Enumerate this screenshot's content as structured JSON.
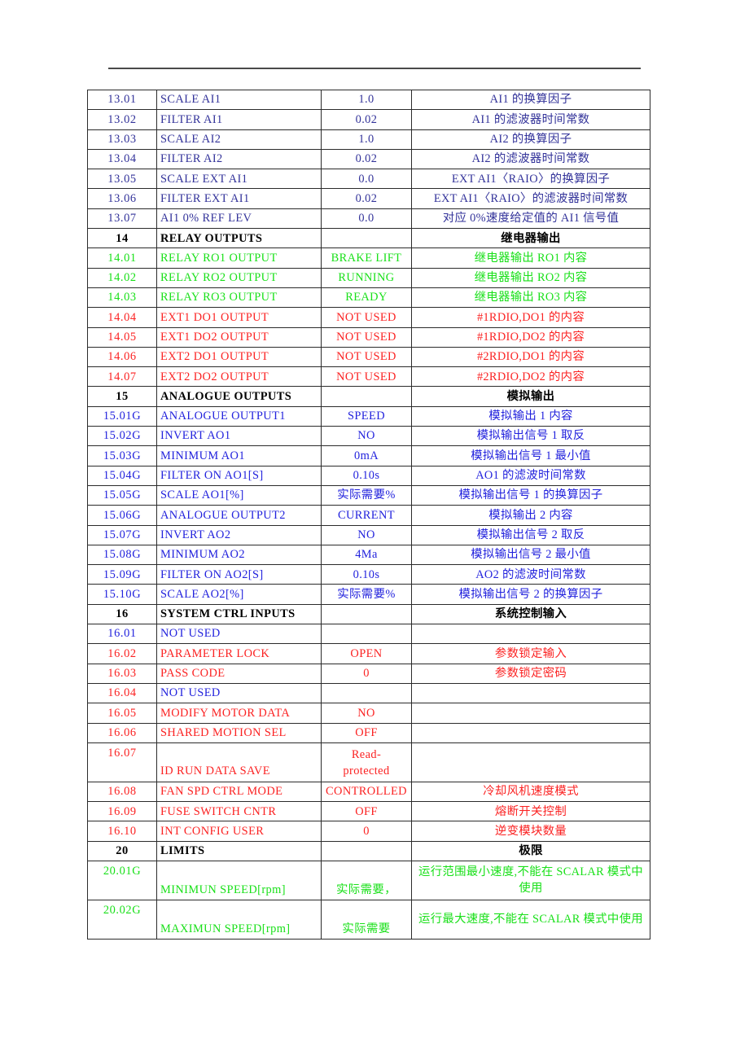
{
  "document": {
    "header_rule": true,
    "colors": {
      "navy": "#33339a",
      "blue": "#2222dd",
      "green": "#19e019",
      "red": "#fb2222",
      "black": "#000000",
      "border": "#2b2b2b",
      "rule": "#4a4a4a"
    }
  },
  "table": {
    "columns": [
      "id",
      "name",
      "value",
      "description"
    ],
    "rows": [
      {
        "type": "row",
        "id": "13.01",
        "name": "SCALE AI1",
        "value": "1.0",
        "desc": "AI1 的换算因子",
        "color": "navy"
      },
      {
        "type": "row",
        "id": "13.02",
        "name": "FILTER AI1",
        "value": "0.02",
        "desc": "AI1 的滤波器时间常数",
        "color": "navy"
      },
      {
        "type": "row",
        "id": "13.03",
        "name": "SCALE AI2",
        "value": "1.0",
        "desc": "AI2 的换算因子",
        "color": "navy"
      },
      {
        "type": "row",
        "id": "13.04",
        "name": "FILTER AI2",
        "value": "0.02",
        "desc": "AI2 的滤波器时间常数",
        "color": "navy"
      },
      {
        "type": "row",
        "id": "13.05",
        "name": "SCALE EXT AI1",
        "value": "0.0",
        "desc": "EXT AI1〈RAIO〉的换算因子",
        "color": "navy"
      },
      {
        "type": "row",
        "id": "13.06",
        "name": "FILTER EXT AI1",
        "value": "0.02",
        "desc": "EXT AI1〈RAIO〉的滤波器时间常数",
        "color": "navy"
      },
      {
        "type": "row",
        "id": "13.07",
        "name": "AI1 0% REF LEV",
        "value": "0.0",
        "desc": "对应 0%速度给定值的 AI1 信号值",
        "color": "navy"
      },
      {
        "type": "section",
        "id": "14",
        "name": "RELAY OUTPUTS",
        "value": "",
        "desc": "继电器输出",
        "color": "black"
      },
      {
        "type": "row",
        "id": "14.01",
        "name": "RELAY RO1 OUTPUT",
        "value": "BRAKE LIFT",
        "desc": "继电器输出 RO1 内容",
        "color": "green"
      },
      {
        "type": "row",
        "id": "14.02",
        "name": "RELAY RO2 OUTPUT",
        "value": "RUNNING",
        "desc": "继电器输出 RO2 内容",
        "color": "green"
      },
      {
        "type": "row",
        "id": "14.03",
        "name": "RELAY RO3 OUTPUT",
        "value": "READY",
        "desc": "继电器输出 RO3 内容",
        "color": "green"
      },
      {
        "type": "row",
        "id": "14.04",
        "name": "EXT1 DO1 OUTPUT",
        "value": "NOT USED",
        "desc": "#1RDIO,DO1 的内容",
        "color": "red"
      },
      {
        "type": "row",
        "id": "14.05",
        "name": "EXT1 DO2 OUTPUT",
        "value": "NOT USED",
        "desc": "#1RDIO,DO2 的内容",
        "color": "red"
      },
      {
        "type": "row",
        "id": "14.06",
        "name": "EXT2 DO1 OUTPUT",
        "value": "NOT USED",
        "desc": "#2RDIO,DO1 的内容",
        "color": "red"
      },
      {
        "type": "row",
        "id": "14.07",
        "name": "EXT2 DO2 OUTPUT",
        "value": "NOT USED",
        "desc": "#2RDIO,DO2 的内容",
        "color": "red"
      },
      {
        "type": "section",
        "id": "15",
        "name": "ANALOGUE OUTPUTS",
        "value": "",
        "desc": "模拟输出",
        "color": "black"
      },
      {
        "type": "row",
        "id": "15.01G",
        "name": "ANALOGUE OUTPUT1",
        "value": "SPEED",
        "desc": "模拟输出 1 内容",
        "color": "blue"
      },
      {
        "type": "row",
        "id": "15.02G",
        "name": "INVERT AO1",
        "value": "NO",
        "desc": "模拟输出信号 1 取反",
        "color": "blue"
      },
      {
        "type": "row",
        "id": "15.03G",
        "name": "MINIMUM AO1",
        "value": "0mA",
        "desc": "模拟输出信号 1 最小值",
        "color": "blue"
      },
      {
        "type": "row",
        "id": "15.04G",
        "name": "FILTER ON AO1[S]",
        "value": "0.10s",
        "desc": "AO1 的滤波时间常数",
        "color": "blue"
      },
      {
        "type": "row",
        "id": "15.05G",
        "name": "SCALE AO1[%]",
        "value": "实际需要%",
        "desc": "模拟输出信号 1 的换算因子",
        "color": "blue"
      },
      {
        "type": "row",
        "id": "15.06G",
        "name": "ANALOGUE OUTPUT2",
        "value": "CURRENT",
        "desc": "模拟输出 2 内容",
        "color": "blue"
      },
      {
        "type": "row",
        "id": "15.07G",
        "name": "INVERT AO2",
        "value": "NO",
        "desc": "模拟输出信号 2 取反",
        "color": "blue"
      },
      {
        "type": "row",
        "id": "15.08G",
        "name": "MINIMUM AO2",
        "value": "4Ma",
        "desc": "模拟输出信号 2 最小值",
        "color": "blue"
      },
      {
        "type": "row",
        "id": "15.09G",
        "name": "FILTER ON AO2[S]",
        "value": "0.10s",
        "desc": "AO2 的滤波时间常数",
        "color": "blue"
      },
      {
        "type": "row",
        "id": "15.10G",
        "name": "SCALE AO2[%]",
        "value": "实际需要%",
        "desc": "模拟输出信号 2 的换算因子",
        "color": "blue"
      },
      {
        "type": "section",
        "id": "16",
        "name": "SYSTEM CTRL INPUTS",
        "value": "",
        "desc": "系统控制输入",
        "color": "black"
      },
      {
        "type": "row",
        "id": "16.01",
        "name": "NOT USED",
        "value": "",
        "desc": "",
        "color": "blue",
        "id_color": "blue"
      },
      {
        "type": "row",
        "id": "16.02",
        "name": "PARAMETER LOCK",
        "value": "OPEN",
        "desc": "参数锁定输入",
        "color": "red"
      },
      {
        "type": "row",
        "id": "16.03",
        "name": "PASS CODE",
        "value": "0",
        "desc": "参数锁定密码",
        "color": "red"
      },
      {
        "type": "row",
        "id": "16.04",
        "name": "NOT USED",
        "value": "",
        "desc": "",
        "color": "blue",
        "id_color": "red"
      },
      {
        "type": "row",
        "id": "16.05",
        "name": "MODIFY MOTOR DATA",
        "value": "NO",
        "desc": "",
        "color": "red"
      },
      {
        "type": "row",
        "id": "16.06",
        "name": "SHARED MOTION SEL",
        "value": "OFF",
        "desc": "",
        "color": "red"
      },
      {
        "type": "tall",
        "id": "16.07",
        "name": "ID RUN DATA SAVE",
        "value": "Read-\nprotected",
        "desc": "",
        "color": "red"
      },
      {
        "type": "row",
        "id": "16.08",
        "name": "FAN SPD CTRL MODE",
        "value": "CONTROLLED",
        "desc": "冷却风机速度模式",
        "color": "red"
      },
      {
        "type": "row",
        "id": "16.09",
        "name": "FUSE SWITCH CNTR",
        "value": "OFF",
        "desc": "熔断开关控制",
        "color": "red"
      },
      {
        "type": "row",
        "id": "16.10",
        "name": "INT CONFIG USER",
        "value": "0",
        "desc": "逆变模块数量",
        "color": "red"
      },
      {
        "type": "section",
        "id": "20",
        "name": "LIMITS",
        "value": "",
        "desc": "极限",
        "color": "black"
      },
      {
        "type": "tall",
        "id": "20.01G",
        "name": "MINIMUN SPEED[rpm]",
        "value": "实际需要，",
        "desc": "运行范围最小速度,不能在 SCALAR 模式中使用",
        "color": "green"
      },
      {
        "type": "tall",
        "id": "20.02G",
        "name": "MAXIMUN SPEED[rpm]",
        "value": "实际需要",
        "desc": "运行最大速度,不能在 SCALAR 模式中使用",
        "color": "green"
      }
    ]
  }
}
